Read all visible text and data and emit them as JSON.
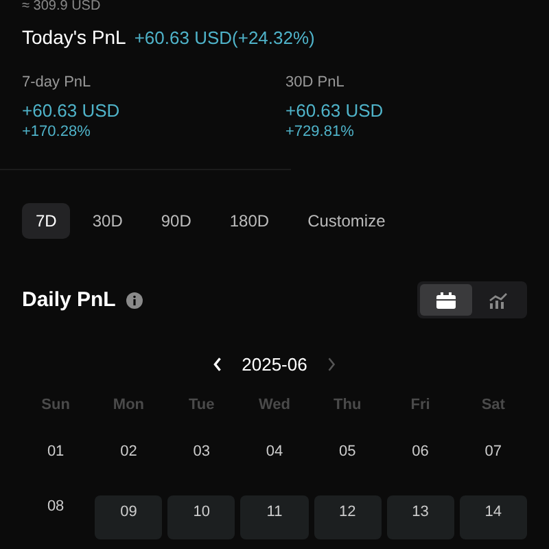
{
  "balance_note": "≈ 309.9 USD",
  "today": {
    "label": "Today's PnL",
    "value": "+60.63 USD(+24.32%)"
  },
  "stats": [
    {
      "label": "7-day PnL",
      "value": "+60.63 USD",
      "percent": "+170.28%"
    },
    {
      "label": "30D PnL",
      "value": "+60.63 USD",
      "percent": "+729.81%"
    }
  ],
  "ranges": [
    {
      "label": "7D",
      "selected": true
    },
    {
      "label": "30D",
      "selected": false
    },
    {
      "label": "90D",
      "selected": false
    },
    {
      "label": "180D",
      "selected": false
    },
    {
      "label": "Customize",
      "selected": false
    }
  ],
  "daily": {
    "title": "Daily PnL",
    "views": [
      {
        "kind": "calendar",
        "selected": true
      },
      {
        "kind": "chart",
        "selected": false
      }
    ]
  },
  "month": "2025-06",
  "weekdays": [
    "Sun",
    "Mon",
    "Tue",
    "Wed",
    "Thu",
    "Fri",
    "Sat"
  ],
  "days": [
    {
      "label": "01",
      "has_data": false
    },
    {
      "label": "02",
      "has_data": false
    },
    {
      "label": "03",
      "has_data": false
    },
    {
      "label": "04",
      "has_data": false
    },
    {
      "label": "05",
      "has_data": false
    },
    {
      "label": "06",
      "has_data": false
    },
    {
      "label": "07",
      "has_data": false
    },
    {
      "label": "08",
      "has_data": false
    },
    {
      "label": "09",
      "has_data": true
    },
    {
      "label": "10",
      "has_data": true
    },
    {
      "label": "11",
      "has_data": true
    },
    {
      "label": "12",
      "has_data": true
    },
    {
      "label": "13",
      "has_data": true
    },
    {
      "label": "14",
      "has_data": true
    }
  ]
}
